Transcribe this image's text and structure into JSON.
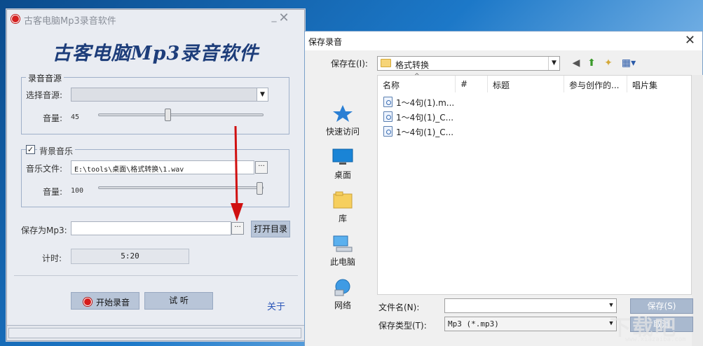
{
  "recorder": {
    "title": "古客电脑Mp3录音软件",
    "banner": "古客电脑Mp3录音软件",
    "source_group": {
      "legend": "录音音源",
      "select_label": "选择音源:",
      "select_value": "",
      "volume_label": "音量:",
      "volume_value": "45"
    },
    "music_group": {
      "legend": "背景音乐",
      "checked": true,
      "file_label": "音乐文件:",
      "file_value": "E:\\tools\\桌面\\格式转换\\1.wav",
      "volume_label": "音量:",
      "volume_value": "100"
    },
    "save_label": "保存为Mp3:",
    "save_value": "",
    "browse_label": "···",
    "open_dir_button": "打开目录",
    "timer_label": "计时:",
    "timer_value": "5:20",
    "start_button": "开始录音",
    "listen_button": "试 听",
    "about_link": "关于"
  },
  "dialog": {
    "title": "保存录音",
    "save_in_label": "保存在(I):",
    "save_in_value": "格式转换",
    "places": [
      {
        "label": "快速访问",
        "icon": "star-icon"
      },
      {
        "label": "桌面",
        "icon": "desktop-icon"
      },
      {
        "label": "库",
        "icon": "library-icon"
      },
      {
        "label": "此电脑",
        "icon": "computer-icon"
      },
      {
        "label": "网络",
        "icon": "network-icon"
      }
    ],
    "columns": [
      "名称",
      "#",
      "标题",
      "参与创作的...",
      "唱片集"
    ],
    "files": [
      "1～4句(1).m...",
      "1～4句(1)_C...",
      "1～4句(1)_C..."
    ],
    "filename_label": "文件名(N):",
    "filename_value": "",
    "filetype_label": "保存类型(T):",
    "filetype_value": "Mp3 (*.mp3)",
    "save_button": "保存(S)",
    "cancel_button": "取消"
  },
  "watermark": {
    "text": "下载吧",
    "sub": "www.xiazaiba.com"
  },
  "colors": {
    "banner": "#1d3d7a",
    "button": "#b8c5d8",
    "dialog_button": "#a9b9cf",
    "arrow": "#d01010",
    "about_link": "#2a55b8"
  }
}
